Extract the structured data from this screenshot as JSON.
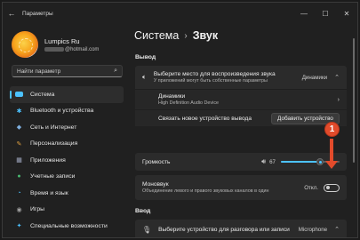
{
  "window": {
    "title": "Параметры",
    "minimize": "—",
    "maximize": "☐",
    "close": "✕"
  },
  "profile": {
    "name": "Lumpics Ru",
    "email_suffix": "@hotmail.com"
  },
  "search": {
    "placeholder": "Найти параметр"
  },
  "sidebar": {
    "items": [
      {
        "label": "Система",
        "icon": "system-icon",
        "color": "#4cc2ff",
        "active": true
      },
      {
        "label": "Bluetooth и устройства",
        "icon": "bluetooth-icon",
        "color": "#4cc2ff"
      },
      {
        "label": "Сеть и Интернет",
        "icon": "network-icon",
        "color": "#7fb0e0"
      },
      {
        "label": "Персонализация",
        "icon": "brush-icon",
        "color": "#e0a040"
      },
      {
        "label": "Приложения",
        "icon": "apps-icon",
        "color": "#a0a8c0"
      },
      {
        "label": "Учетные записи",
        "icon": "accounts-icon",
        "color": "#48b870"
      },
      {
        "label": "Время и язык",
        "icon": "time-language-icon",
        "color": "#4cc2ff"
      },
      {
        "label": "Игры",
        "icon": "games-icon",
        "color": "#a0a0a0"
      },
      {
        "label": "Специальные возможности",
        "icon": "accessibility-icon",
        "color": "#4cc2ff"
      }
    ]
  },
  "header": {
    "parent": "Система",
    "separator": "›",
    "current": "Звук"
  },
  "output": {
    "section": "Вывод",
    "choose_title": "Выберите место для воспроизведения звука",
    "choose_sub": "У приложений могут быть собственные параметры",
    "choose_value": "Динамики",
    "device_name": "Динамики",
    "device_sub": "High Definition Audio Device",
    "pair_label": "Связать новое устройство вывода",
    "add_button": "Добавить устройство",
    "volume_label": "Громкость",
    "volume_value": "67",
    "volume_level": 0.67,
    "mono_title": "Моноввук",
    "mono_sub": "Объединение левого и правого звуковых каналов в один",
    "mono_state": "Откл."
  },
  "input": {
    "section": "Ввод",
    "choose_title": "Выберите устройство для разговора или записи",
    "choose_value": "Microphone"
  },
  "annotation": {
    "step": "1",
    "color": "#e24b2b"
  }
}
